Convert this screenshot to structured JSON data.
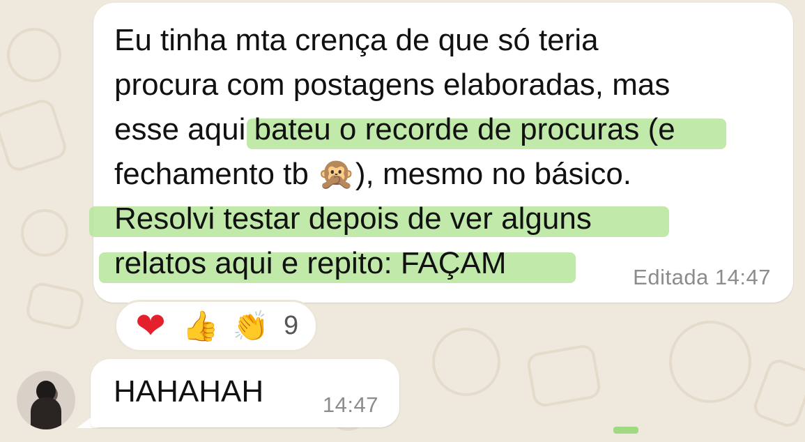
{
  "messages": [
    {
      "text_part1": "Eu tinha mta crença de que só teria\nprocura com postagens elaboradas, mas\nesse aqui bateu o recorde de procuras (e\nfechamento tb ",
      "emoji_icon": "see-no-evil-monkey",
      "text_part2": "), mesmo no básico.\nResolvi testar depois de ver alguns\nrelatos aqui e repito: FAÇAM",
      "edited_label": "Editada",
      "time": "14:47"
    },
    {
      "text": "HAHAHAH",
      "time": "14:47"
    }
  ],
  "reactions": {
    "icons": [
      "heart",
      "thumbs-up",
      "clapping-hands"
    ],
    "count": "9"
  },
  "colors": {
    "chat_background": "#efe8dc",
    "bubble": "#ffffff",
    "highlight": "#b6e59a",
    "meta_text": "#8c8c8c"
  }
}
